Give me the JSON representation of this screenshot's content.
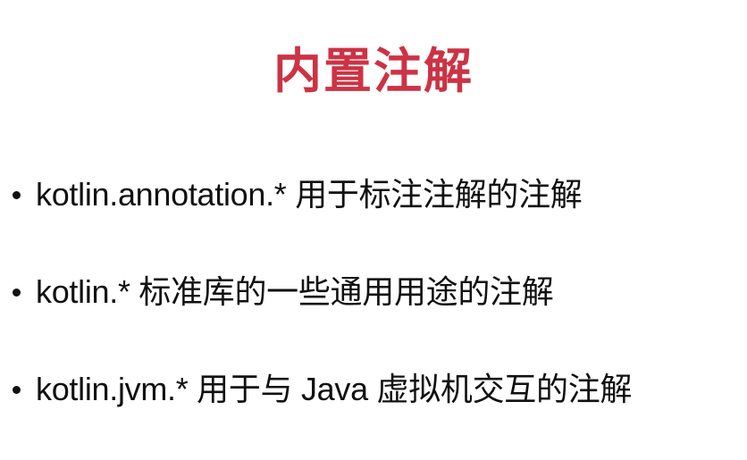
{
  "slide": {
    "title": "内置注解",
    "title_color": "#cc3344",
    "bullets": [
      {
        "text": "kotlin.annotation.* 用于标注注解的注解"
      },
      {
        "text": "kotlin.*  标准库的一些通用用途的注解"
      },
      {
        "text": "kotlin.jvm.* 用于与 Java 虚拟机交互的注解"
      }
    ]
  }
}
